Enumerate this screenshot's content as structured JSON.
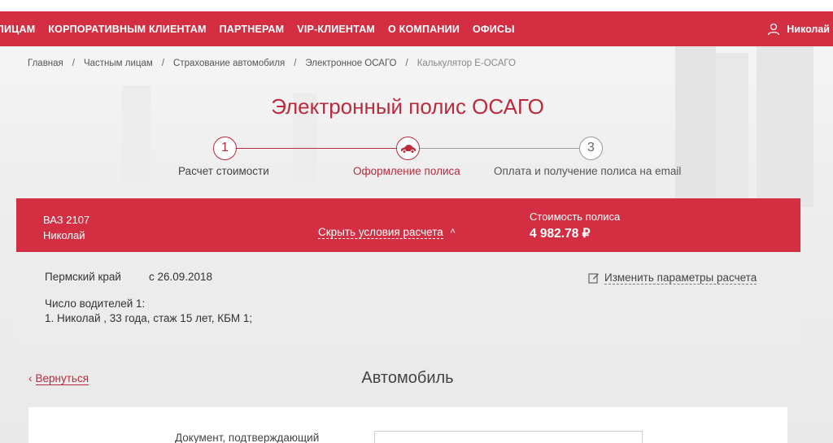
{
  "nav": {
    "items": [
      "ЛИЦАМ",
      "КОРПОРАТИВНЫМ КЛИЕНТАМ",
      "ПАРТНЕРАМ",
      "VIP-КЛИЕНТАМ",
      "О КОМПАНИИ",
      "ОФИСЫ"
    ],
    "user_name": "Николай"
  },
  "breadcrumb": [
    "Главная",
    "Частным лицам",
    "Страхование автомобиля",
    "Электронное ОСАГО"
  ],
  "breadcrumb_current": "Калькулятор Е-ОСАГО",
  "page_title": "Электронный полис ОСАГО",
  "steps": [
    {
      "number": "1",
      "label": "Расчет стоимости",
      "state": "done"
    },
    {
      "number": "",
      "label": "Оформление полиса",
      "state": "active",
      "icon": "car-icon"
    },
    {
      "number": "3",
      "label": "Оплата и получение полиса на email",
      "state": "pending"
    }
  ],
  "summary": {
    "car": "ВАЗ 2107",
    "owner": "Николай",
    "toggle_label": "Скрыть условия расчета",
    "price_label": "Стоимость полиса",
    "price": "4 982.78 ₽"
  },
  "conditions": {
    "region": "Пермский край",
    "date": "с 26.09.2018",
    "drivers_count": "Число водителей 1:",
    "driver_1": "1. Николай , 33 года, стаж 15 лет, КБМ 1;",
    "edit_label": "Изменить параметры расчета"
  },
  "back_label": "Вернуться",
  "section_title": "Автомобиль",
  "form": {
    "doc_label": "Документ, подтверждающий"
  },
  "colors": {
    "brand_red": "#d42e43",
    "title_red": "#b92b3d"
  }
}
